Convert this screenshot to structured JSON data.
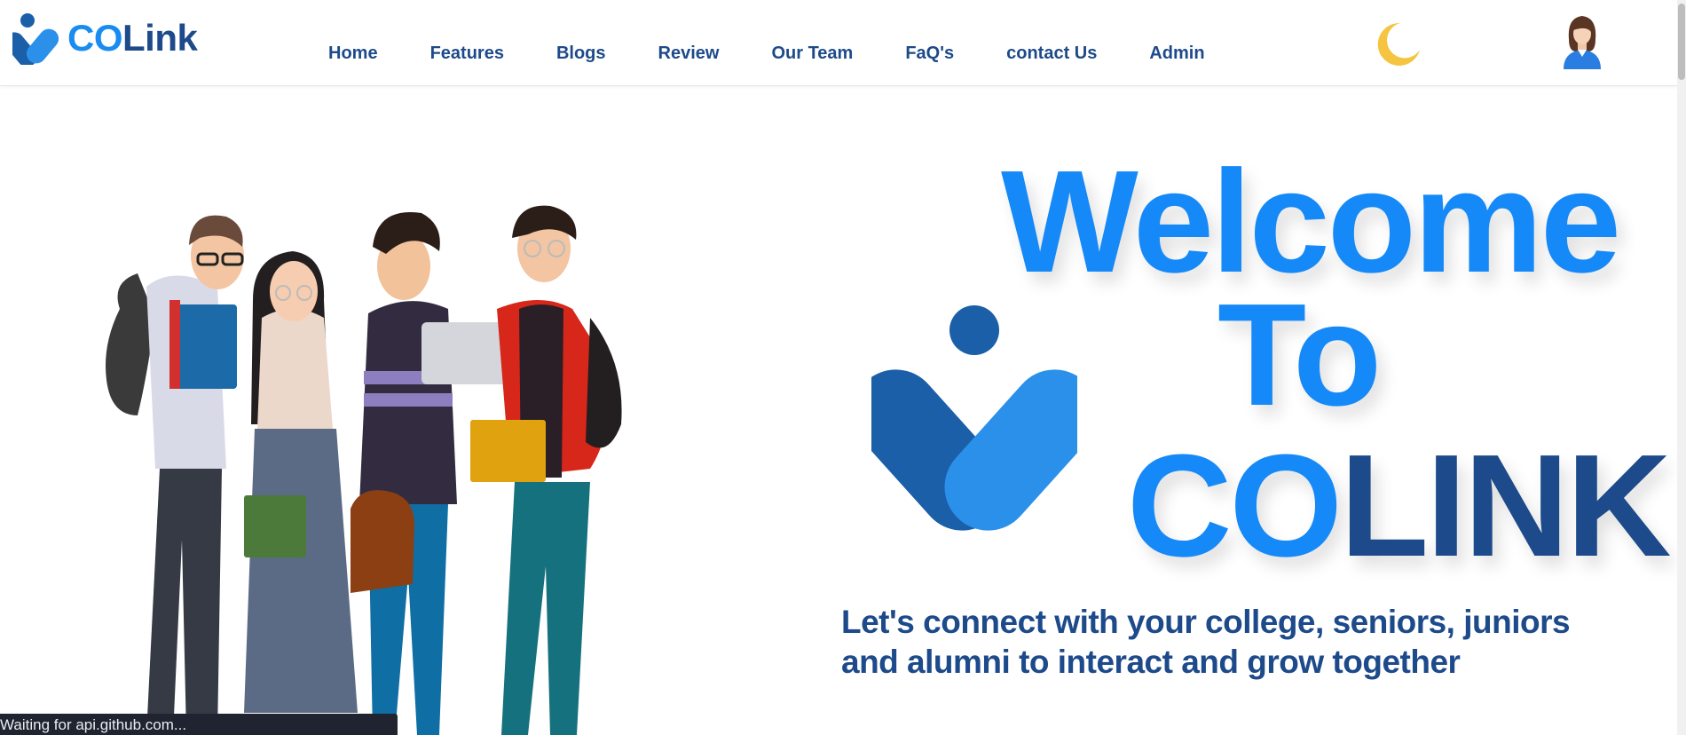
{
  "brand": {
    "co": "CO",
    "rest": "Link",
    "logo_icon": "colink-logo-icon"
  },
  "nav": {
    "links": [
      "Home",
      "Features",
      "Blogs",
      "Review",
      "Our Team",
      "FaQ's",
      "contact Us",
      "Admin"
    ],
    "theme_toggle_icon": "moon-icon",
    "profile_icon": "avatar-icon"
  },
  "hero": {
    "welcome_line1": "Welcome",
    "welcome_line2": "To",
    "welcome_line3_co": "CO",
    "welcome_line3_rest": "LINK",
    "tagline": "Let's connect with your college, seniors, juniors and alumni to interact and grow together",
    "illustration": "students-group-illustration"
  },
  "status_bar": {
    "text": "Waiting for api.github.com..."
  },
  "colors": {
    "primary_blue": "#1589f7",
    "navy": "#1d4a8a",
    "moon": "#f5c542"
  }
}
